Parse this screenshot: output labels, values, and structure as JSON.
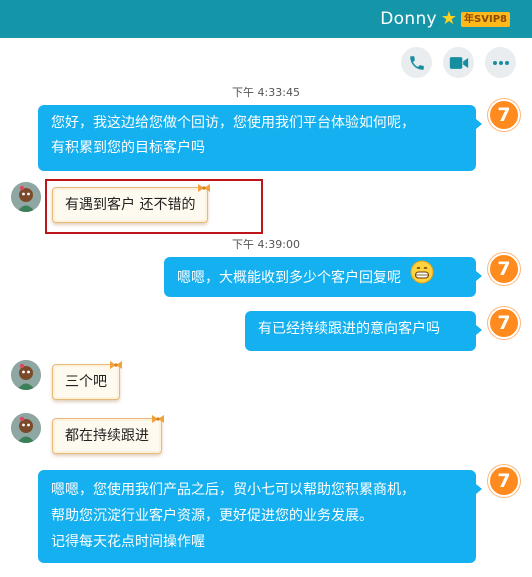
{
  "header": {
    "contact_name": "Donny",
    "vip_badge": "年SVIP8"
  },
  "toolbar": {
    "icons": [
      "phone-icon",
      "video-icon",
      "more-icon"
    ]
  },
  "timestamps": [
    "下午 4:33:45",
    "下午 4:39:00"
  ],
  "messages": [
    {
      "from": "agent",
      "lines": [
        "您好，我这边给您做个回访，您使用我们平台体验如何呢，",
        "有积累到您的目标客户吗"
      ]
    },
    {
      "from": "customer",
      "text": "有遇到客户 还不错的"
    },
    {
      "from": "agent",
      "text": "嗯嗯，大概能收到多少个客户回复呢"
    },
    {
      "from": "agent",
      "text": "有已经持续跟进的意向客户吗"
    },
    {
      "from": "customer",
      "text": "三个吧"
    },
    {
      "from": "customer",
      "text": "都在持续跟进"
    },
    {
      "from": "agent",
      "lines": [
        "嗯嗯，您使用我们产品之后，贸小七可以帮助您积累商机，",
        "帮助您沉淀行业客户资源，更好促进您的业务发展。",
        "记得每天花点时间操作喔"
      ]
    }
  ],
  "colors": {
    "header_bg": "#1596a8",
    "outgoing_bubble": "#14b0f0",
    "incoming_border": "#e9b97a",
    "highlight": "#c0141b",
    "agent_avatar": "#ff8a1d"
  }
}
